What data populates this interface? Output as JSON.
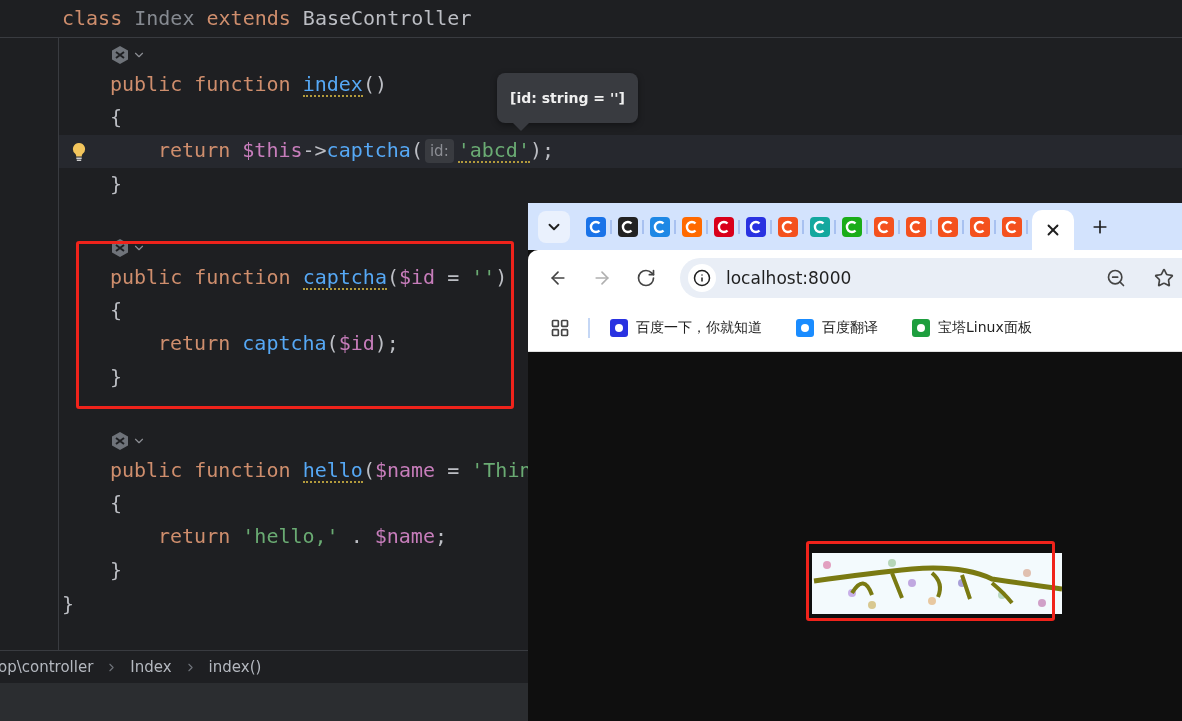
{
  "editor": {
    "header": {
      "tokens": [
        {
          "kind": "keyword",
          "text": "class ",
          "warning": false
        },
        {
          "kind": "type",
          "text": "Index",
          "warning": false
        },
        {
          "kind": "keyword",
          "text": " extends ",
          "warning": false
        },
        {
          "kind": "plain",
          "text": "BaseController",
          "warning": false
        }
      ]
    },
    "methods": [
      {
        "highlighted": false,
        "lines": [
          {
            "kind": "vision",
            "current": false
          },
          {
            "kind": "signature",
            "current": false,
            "tokens": [
              {
                "kind": "keyword",
                "text": "public function ",
                "warning": false
              },
              {
                "kind": "function",
                "text": "index",
                "warning": true
              },
              {
                "kind": "plain",
                "text": "()",
                "warning": false
              }
            ]
          },
          {
            "kind": "signature",
            "current": false,
            "tokens": [
              {
                "kind": "plain",
                "text": "{",
                "warning": false
              }
            ]
          },
          {
            "kind": "body",
            "current": true,
            "tokens": [
              {
                "kind": "keyword",
                "text": "return ",
                "warning": false
              },
              {
                "kind": "variable",
                "text": "$this",
                "warning": false
              },
              {
                "kind": "plain",
                "text": "->",
                "warning": false
              },
              {
                "kind": "function",
                "text": "captcha",
                "warning": false
              },
              {
                "kind": "plain",
                "text": "(",
                "warning": false
              },
              {
                "kind": "hint",
                "text": "id:",
                "warning": false
              },
              {
                "kind": "string",
                "text": "'abcd'",
                "warning": true
              },
              {
                "kind": "plain",
                "text": ");",
                "warning": false
              }
            ]
          },
          {
            "kind": "signature",
            "current": false,
            "tokens": [
              {
                "kind": "plain",
                "text": "}",
                "warning": false
              }
            ]
          }
        ]
      },
      {
        "highlighted": true,
        "lines": [
          {
            "kind": "vision",
            "current": false
          },
          {
            "kind": "signature",
            "current": false,
            "tokens": [
              {
                "kind": "keyword",
                "text": "public function ",
                "warning": false
              },
              {
                "kind": "function",
                "text": "captcha",
                "warning": true
              },
              {
                "kind": "plain",
                "text": "(",
                "warning": false
              },
              {
                "kind": "variable",
                "text": "$id",
                "warning": false
              },
              {
                "kind": "plain",
                "text": " = ",
                "warning": false
              },
              {
                "kind": "string",
                "text": "''",
                "warning": false
              },
              {
                "kind": "plain",
                "text": ")",
                "warning": false
              }
            ]
          },
          {
            "kind": "signature",
            "current": false,
            "tokens": [
              {
                "kind": "plain",
                "text": "{",
                "warning": false
              }
            ]
          },
          {
            "kind": "body",
            "current": false,
            "tokens": [
              {
                "kind": "keyword",
                "text": "return ",
                "warning": false
              },
              {
                "kind": "function",
                "text": "captcha",
                "warning": false
              },
              {
                "kind": "plain",
                "text": "(",
                "warning": false
              },
              {
                "kind": "variable",
                "text": "$id",
                "warning": false
              },
              {
                "kind": "plain",
                "text": ");",
                "warning": false
              }
            ]
          },
          {
            "kind": "signature",
            "current": false,
            "tokens": [
              {
                "kind": "plain",
                "text": "}",
                "warning": false
              }
            ]
          }
        ]
      },
      {
        "highlighted": false,
        "lines": [
          {
            "kind": "vision",
            "current": false
          },
          {
            "kind": "signature",
            "current": false,
            "tokens": [
              {
                "kind": "keyword",
                "text": "public function ",
                "warning": false
              },
              {
                "kind": "function",
                "text": "hello",
                "warning": true
              },
              {
                "kind": "plain",
                "text": "(",
                "warning": false
              },
              {
                "kind": "variable",
                "text": "$name",
                "warning": false
              },
              {
                "kind": "plain",
                "text": " = ",
                "warning": false
              },
              {
                "kind": "string",
                "text": "'Thin",
                "warning": false
              }
            ]
          },
          {
            "kind": "signature",
            "current": false,
            "tokens": [
              {
                "kind": "plain",
                "text": "{",
                "warning": false
              }
            ]
          },
          {
            "kind": "body",
            "current": false,
            "tokens": [
              {
                "kind": "keyword",
                "text": "return ",
                "warning": false
              },
              {
                "kind": "string",
                "text": "'hello,'",
                "warning": false
              },
              {
                "kind": "plain",
                "text": " . ",
                "warning": false
              },
              {
                "kind": "variable",
                "text": "$name",
                "warning": false
              },
              {
                "kind": "plain",
                "text": ";",
                "warning": false
              }
            ]
          },
          {
            "kind": "signature",
            "current": false,
            "tokens": [
              {
                "kind": "plain",
                "text": "}",
                "warning": false
              }
            ]
          }
        ]
      }
    ],
    "closing": "}",
    "tooltip": "[id: string = '']",
    "breadcrumbs": [
      "op\\controller",
      "Index",
      "index()"
    ]
  },
  "browser": {
    "tabs": [
      {
        "color": "#1a73e8",
        "selected": false
      },
      {
        "color": "#222222",
        "selected": false
      },
      {
        "color": "#1e88e5",
        "selected": false
      },
      {
        "color": "#ff6a00",
        "selected": false
      },
      {
        "color": "#d9001b",
        "selected": false
      },
      {
        "color": "#2932e1",
        "selected": false
      },
      {
        "color": "#f4511e",
        "selected": false
      },
      {
        "color": "#13a89e",
        "selected": false
      },
      {
        "color": "#1aad19",
        "selected": false
      },
      {
        "color": "#f4511e",
        "selected": false
      },
      {
        "color": "#f4511e",
        "selected": false
      },
      {
        "color": "#f4511e",
        "selected": false
      },
      {
        "color": "#f4511e",
        "selected": false
      },
      {
        "color": "#f4511e",
        "selected": false
      },
      {
        "selected": true
      }
    ],
    "nav": [
      {
        "kind": "back",
        "disabled": false
      },
      {
        "kind": "forward",
        "disabled": true
      },
      {
        "kind": "reload",
        "disabled": false
      }
    ],
    "address": "localhost:8000",
    "bookmarks": [
      {
        "color": "#2932e1",
        "label": "百度一下，你就知道"
      },
      {
        "color": "#1a8cff",
        "label": "百度翻译"
      },
      {
        "color": "#1e9e3e",
        "label": "宝塔Linux面板"
      }
    ],
    "page": {
      "captcha": {
        "kind": "picture",
        "highlighted": true
      }
    }
  }
}
